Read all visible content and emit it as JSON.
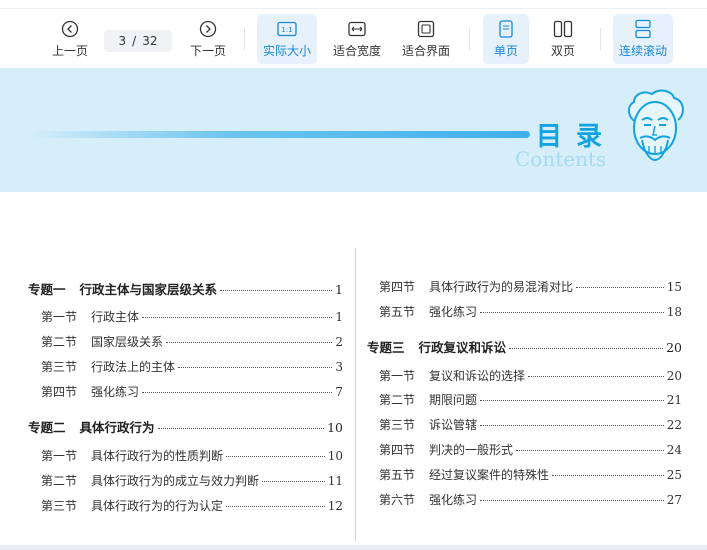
{
  "toolbar": {
    "prev_label": "上一页",
    "next_label": "下一页",
    "current_page": "3",
    "page_sep": "/",
    "total_pages": "32",
    "actual_size_label": "实际大小",
    "actual_size_icon_text": "1:1",
    "fit_width_label": "适合宽度",
    "fit_page_label": "适合界面",
    "single_page_label": "单页",
    "double_page_label": "双页",
    "continuous_label": "连续滚动",
    "accent_color": "#1687d9"
  },
  "banner": {
    "title": "目录",
    "subtitle": "Contents",
    "background_color": "#d6eef9",
    "title_color": "#12a3e0"
  },
  "toc_left": [
    {
      "major": true,
      "num": "专题一",
      "title": "行政主体与国家层级关系",
      "page": "1"
    },
    {
      "major": false,
      "num": "第一节",
      "title": "行政主体",
      "page": "1"
    },
    {
      "major": false,
      "num": "第二节",
      "title": "国家层级关系",
      "page": "2"
    },
    {
      "major": false,
      "num": "第三节",
      "title": "行政法上的主体",
      "page": "3"
    },
    {
      "major": false,
      "num": "第四节",
      "title": "强化练习",
      "page": "7"
    },
    {
      "major": true,
      "num": "专题二",
      "title": "具体行政行为",
      "page": "10"
    },
    {
      "major": false,
      "num": "第一节",
      "title": "具体行政行为的性质判断",
      "page": "10"
    },
    {
      "major": false,
      "num": "第二节",
      "title": "具体行政行为的成立与效力判断",
      "page": "11"
    },
    {
      "major": false,
      "num": "第三节",
      "title": "具体行政行为的行为认定",
      "page": "12"
    }
  ],
  "toc_right": [
    {
      "major": false,
      "num": "第四节",
      "title": "具体行政行为的易混淆对比",
      "page": "15"
    },
    {
      "major": false,
      "num": "第五节",
      "title": "强化练习",
      "page": "18"
    },
    {
      "major": true,
      "num": "专题三",
      "title": "行政复议和诉讼",
      "page": "20"
    },
    {
      "major": false,
      "num": "第一节",
      "title": "复议和诉讼的选择",
      "page": "20"
    },
    {
      "major": false,
      "num": "第二节",
      "title": "期限问题",
      "page": "21"
    },
    {
      "major": false,
      "num": "第三节",
      "title": "诉讼管辖",
      "page": "22"
    },
    {
      "major": false,
      "num": "第四节",
      "title": "判决的一般形式",
      "page": "24"
    },
    {
      "major": false,
      "num": "第五节",
      "title": "经过复议案件的特殊性",
      "page": "25"
    },
    {
      "major": false,
      "num": "第六节",
      "title": "强化练习",
      "page": "27"
    }
  ]
}
